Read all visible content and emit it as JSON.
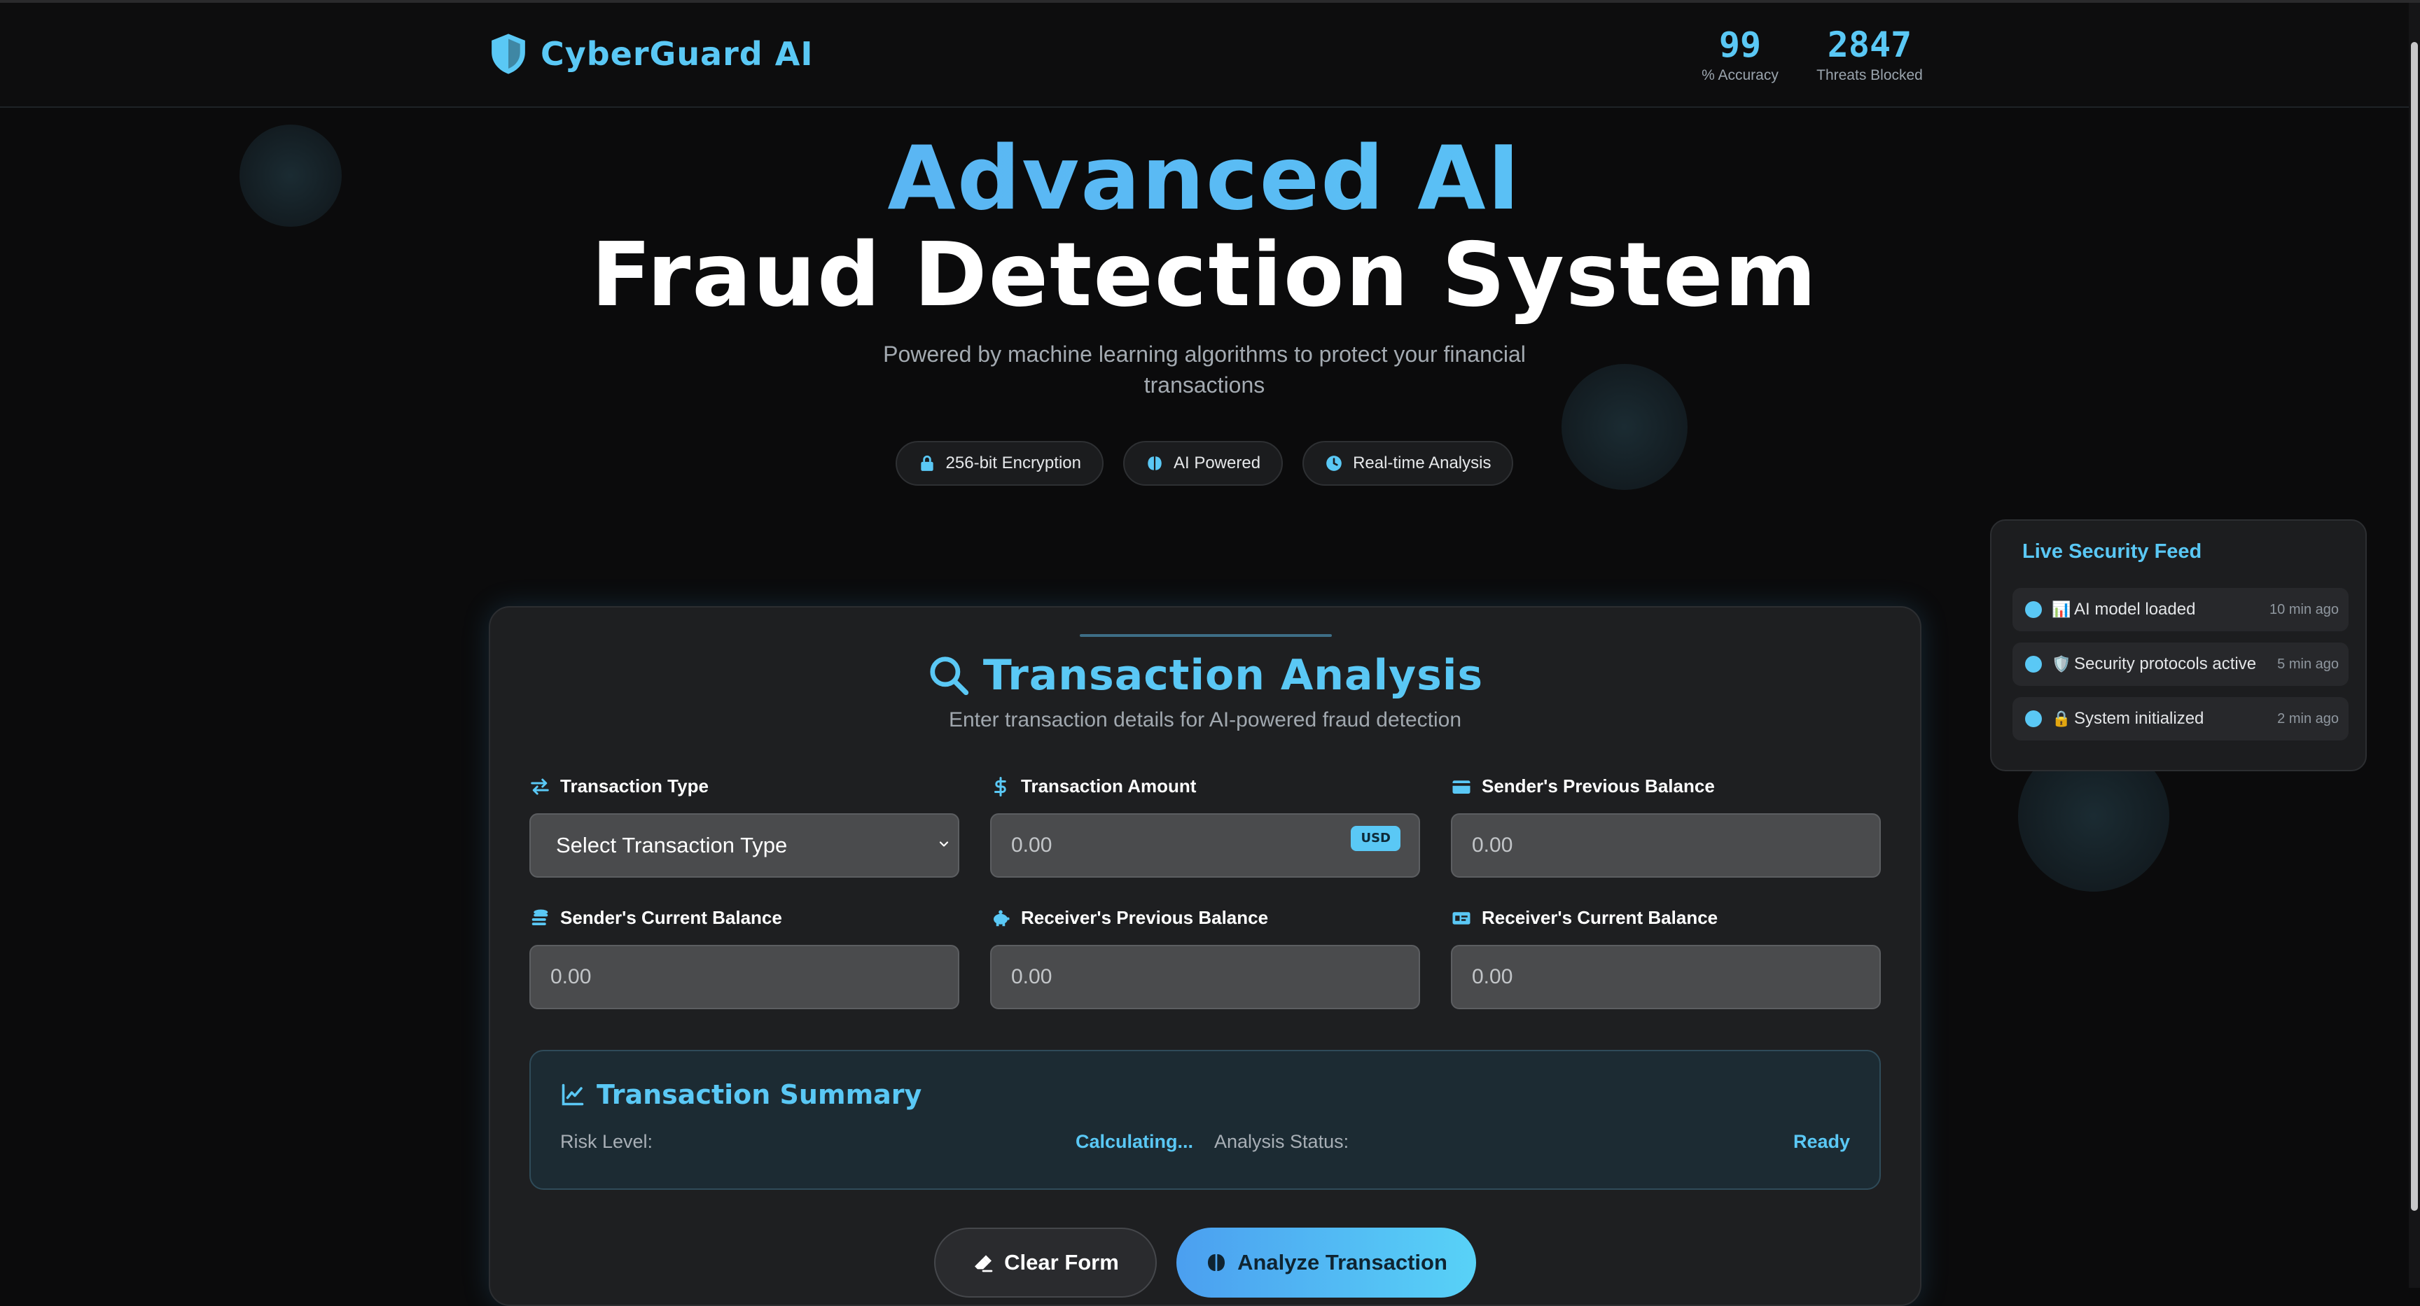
{
  "brand": {
    "name": "CyberGuard AI",
    "accent": "#5ac8f5"
  },
  "header": {
    "stats": [
      {
        "value": "99",
        "label": "% Accuracy"
      },
      {
        "value": "2847",
        "label": "Threats Blocked"
      }
    ]
  },
  "hero": {
    "title_line1": "Advanced AI",
    "title_line2": "Fraud Detection System",
    "subtitle": "Powered by machine learning algorithms to protect your financial transactions",
    "chips": [
      {
        "icon": "lock-icon",
        "label": "256-bit Encryption"
      },
      {
        "icon": "brain-icon",
        "label": "AI Powered"
      },
      {
        "icon": "clock-icon",
        "label": "Real-time Analysis"
      }
    ]
  },
  "live_feed": {
    "title": "Live Security Feed",
    "items": [
      {
        "emoji": "📊",
        "text": "AI model loaded",
        "time": "10 min ago"
      },
      {
        "emoji": "🛡️",
        "text": "Security protocols active",
        "time": "5 min ago"
      },
      {
        "emoji": "🔒",
        "text": "System initialized",
        "time": "2 min ago"
      }
    ]
  },
  "form": {
    "title": "Transaction Analysis",
    "subtitle": "Enter transaction details for AI-powered fraud detection",
    "fields": {
      "transaction_type": {
        "label": "Transaction Type",
        "value": "Select Transaction Type"
      },
      "transaction_amount": {
        "label": "Transaction Amount",
        "placeholder": "0.00",
        "badge": "USD"
      },
      "sender_prev_balance": {
        "label": "Sender's Previous Balance",
        "placeholder": "0.00"
      },
      "sender_curr_balance": {
        "label": "Sender's Current Balance",
        "placeholder": "0.00"
      },
      "receiver_prev_balance": {
        "label": "Receiver's Previous Balance",
        "placeholder": "0.00"
      },
      "receiver_curr_balance": {
        "label": "Receiver's Current Balance",
        "placeholder": "0.00"
      }
    },
    "summary": {
      "title": "Transaction Summary",
      "risk_label": "Risk Level:",
      "risk_value": "Calculating...",
      "status_label": "Analysis Status:",
      "status_value": "Ready"
    },
    "buttons": {
      "clear": "Clear Form",
      "analyze": "Analyze Transaction"
    }
  }
}
